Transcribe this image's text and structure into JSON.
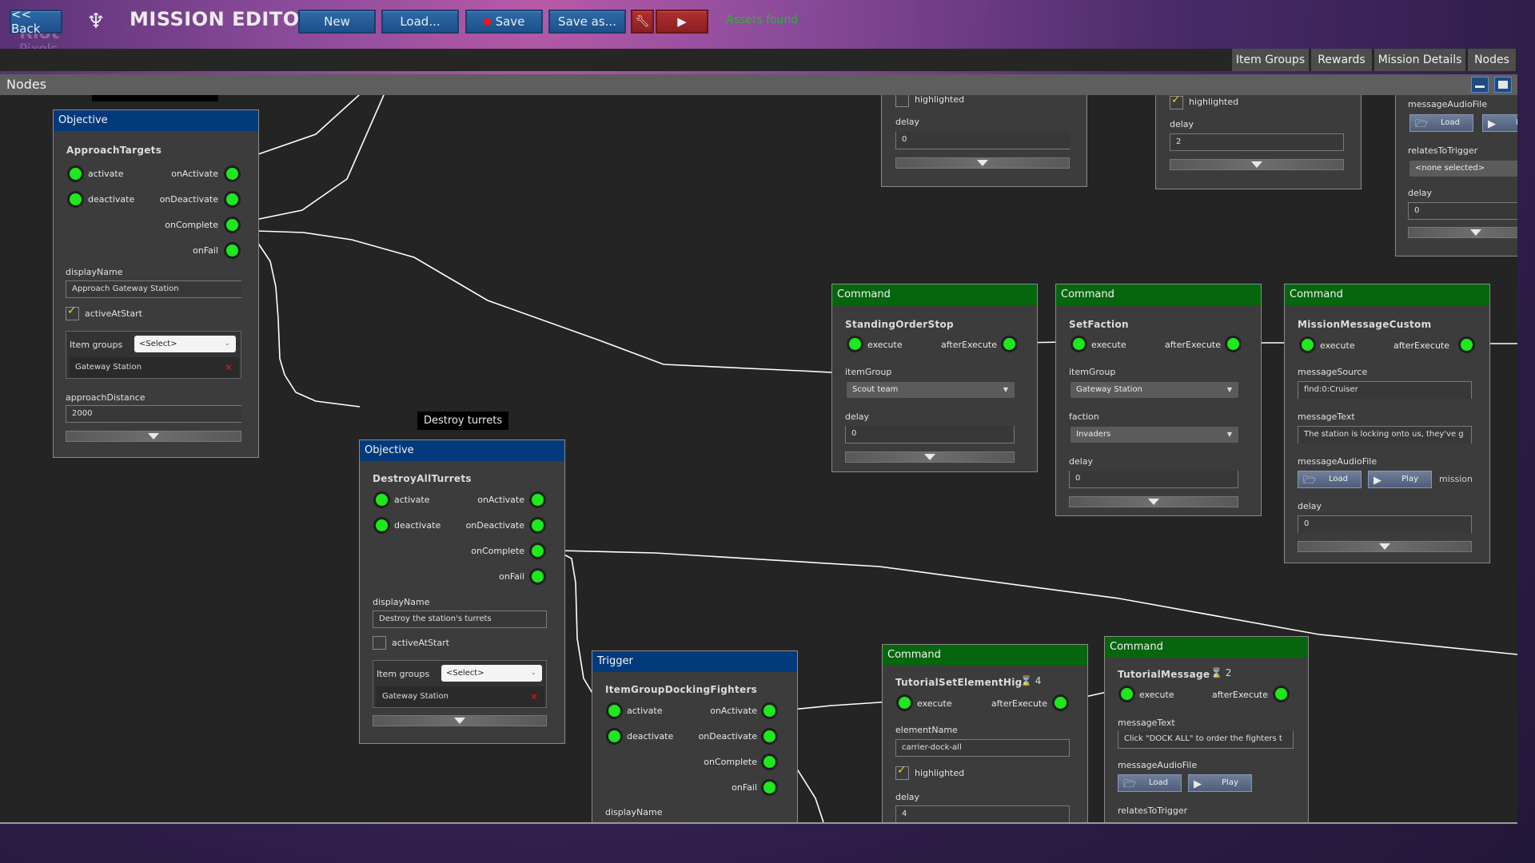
{
  "topbar": {
    "back_label": "<< Back",
    "title": "MISSION EDITOR",
    "new_label": "New",
    "load_label": "Load...",
    "save_label": "Save",
    "save_as_label": "Save as...",
    "wrench_icon": "wrench-icon",
    "play_icon": "play-icon",
    "play_glyph": "▶",
    "wrench_glyph": "🔧",
    "assets_status": "Assets found",
    "logo_glyph": "♆",
    "watermark_top": "Riot",
    "watermark_bottom": "Pixels"
  },
  "tabs": [
    {
      "label": "Item Groups"
    },
    {
      "label": "Rewards"
    },
    {
      "label": "Mission Details"
    },
    {
      "label": "Nodes"
    }
  ],
  "panel": {
    "title": "Nodes"
  },
  "colors": {
    "objective_header": "#033a7c",
    "command_header": "#06660e",
    "port": "#1ee81e",
    "assets_found": "#2bb532"
  },
  "nodes": {
    "approach": {
      "type": "Objective",
      "name": "ApproachTargets",
      "inputs": [
        "activate",
        "deactivate"
      ],
      "outputs": [
        "onActivate",
        "onDeactivate",
        "onComplete",
        "onFail"
      ],
      "displayName_label": "displayName",
      "displayName": "Approach Gateway Station",
      "activeAtStart_label": "activeAtStart",
      "activeAtStart": true,
      "itemGroups_label": "Item groups",
      "itemGroups_select": "<Select>",
      "itemGroups_entry": "Gateway Station",
      "approachDistance_label": "approachDistance",
      "approachDistance": "2000"
    },
    "destroy": {
      "tooltip": "Destroy turrets",
      "type": "Objective",
      "name": "DestroyAllTurrets",
      "inputs": [
        "activate",
        "deactivate"
      ],
      "outputs": [
        "onActivate",
        "onDeactivate",
        "onComplete",
        "onFail"
      ],
      "displayName_label": "displayName",
      "displayName": "Destroy the station's turrets",
      "activeAtStart_label": "activeAtStart",
      "activeAtStart": false,
      "itemGroups_label": "Item groups",
      "itemGroups_select": "<Select>",
      "itemGroups_entry": "Gateway Station"
    },
    "trigger": {
      "type": "Trigger",
      "name": "ItemGroupDockingFighters",
      "inputs": [
        "activate",
        "deactivate"
      ],
      "outputs": [
        "onActivate",
        "onDeactivate",
        "onComplete",
        "onFail"
      ],
      "displayName_label": "displayName"
    },
    "top_a": {
      "highlighted_label": "highlighted",
      "highlighted": false,
      "delay_label": "delay",
      "delay": "0"
    },
    "top_b": {
      "highlighted_label": "highlighted",
      "highlighted": true,
      "delay_label": "delay",
      "delay": "2"
    },
    "top_c": {
      "audio_label": "messageAudioFile",
      "load_label": "Load",
      "play_label": "Play",
      "relates_label": "relatesToTrigger",
      "relates_value": "<none selected>",
      "delay_label": "delay",
      "delay": "0"
    },
    "standing": {
      "type": "Command",
      "name": "StandingOrderStop",
      "in": "execute",
      "out": "afterExecute",
      "itemGroup_label": "itemGroup",
      "itemGroup": "Scout team",
      "delay_label": "delay",
      "delay": "0"
    },
    "faction": {
      "type": "Command",
      "name": "SetFaction",
      "in": "execute",
      "out": "afterExecute",
      "itemGroup_label": "itemGroup",
      "itemGroup": "Gateway Station",
      "faction_label": "faction",
      "faction": "Invaders",
      "delay_label": "delay",
      "delay": "0"
    },
    "custom": {
      "type": "Command",
      "name": "MissionMessageCustom",
      "in": "execute",
      "out": "afterExecute",
      "source_label": "messageSource",
      "source": "find:0:Cruiser",
      "text_label": "messageText",
      "text": "The station is locking onto us, they've g",
      "audio_label": "messageAudioFile",
      "load_label": "Load",
      "play_label": "Play",
      "audio_suffix": "mission",
      "delay_label": "delay",
      "delay": "0"
    },
    "tutorial_hl": {
      "type": "Command",
      "name": "TutorialSetElementHig",
      "hourglass_count": "4",
      "in": "execute",
      "out": "afterExecute",
      "element_label": "elementName",
      "element": "carrier-dock-all",
      "highlighted_label": "highlighted",
      "highlighted": true,
      "delay_label": "delay",
      "delay": "4"
    },
    "tutorial_msg": {
      "type": "Command",
      "name": "TutorialMessage",
      "hourglass_count": "2",
      "in": "execute",
      "out": "afterExecute",
      "text_label": "messageText",
      "text": "Click \"DOCK ALL\" to order the fighters t",
      "audio_label": "messageAudioFile",
      "load_label": "Load",
      "play_label": "Play",
      "relates_label": "relatesToTrigger"
    }
  }
}
